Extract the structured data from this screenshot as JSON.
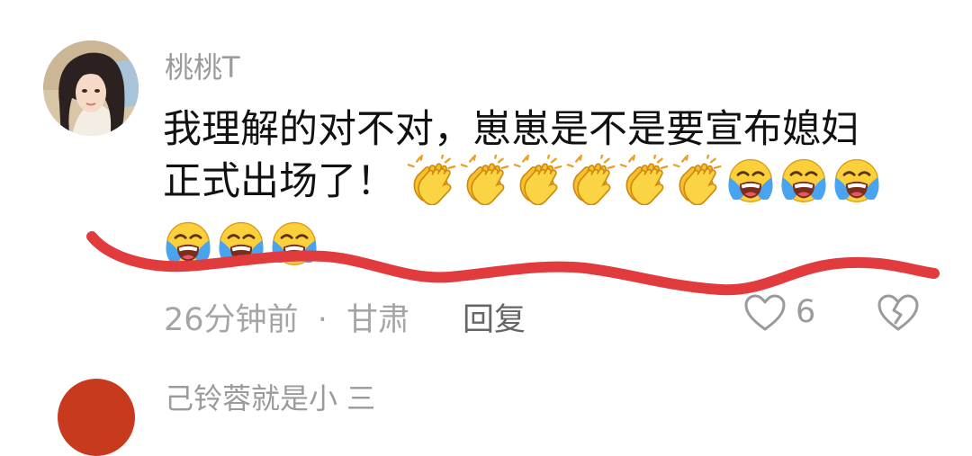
{
  "comment": {
    "username": "桃桃T",
    "text_line1": "我理解的对不对，崽崽是不是要宣布媳妇",
    "text_line2": "正式出场了！",
    "emojis_line2": [
      "clapping-hands",
      "clapping-hands",
      "clapping-hands",
      "clapping-hands",
      "clapping-hands",
      "clapping-hands",
      "loudly-crying-face",
      "loudly-crying-face",
      "loudly-crying-face"
    ],
    "emojis_line3": [
      "loudly-crying-face",
      "loudly-crying-face",
      "loudly-crying-face"
    ],
    "time": "26分钟前",
    "separator": "·",
    "location": "甘肃",
    "reply_label": "回复",
    "like_count": "6"
  },
  "next_comment": {
    "username_partial": "己铃蓉就是小 三"
  },
  "icons": {
    "like": "heart-outline-icon",
    "dislike": "broken-heart-icon"
  },
  "colors": {
    "annotation_line": "#e23b3e",
    "username": "#9b9b9b",
    "text": "#111111"
  }
}
